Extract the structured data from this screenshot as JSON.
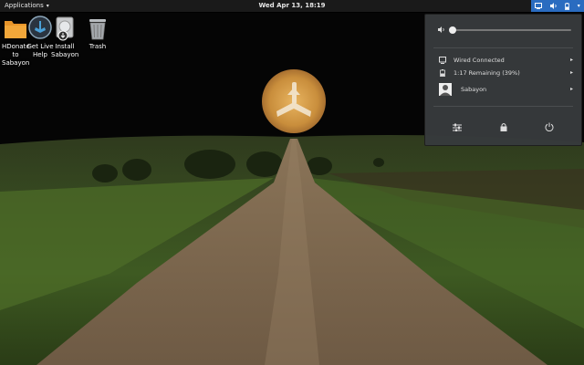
{
  "topbar": {
    "activities_label": "Applications",
    "clock": "Wed Apr 13, 18:19"
  },
  "desktop_icons": [
    {
      "label": "HDonate to Sabayon",
      "icon": "folder-icon"
    },
    {
      "label": "Get Live Help",
      "icon": "sabayon-help-icon"
    },
    {
      "label": "Install Sabayon",
      "icon": "installer-icon"
    },
    {
      "label": "Trash",
      "icon": "trash-icon"
    }
  ],
  "desktop_icon_lines": [
    [
      "HDonate to",
      "Sabayon"
    ],
    [
      "Get Live",
      "Help"
    ],
    [
      "Install",
      "Sabayon"
    ],
    [
      "Trash",
      ""
    ]
  ],
  "system_menu": {
    "volume_level": 0.0,
    "network_label": "Wired Connected",
    "battery_label": "1:17 Remaining (39%)",
    "user_label": "Sabayon"
  },
  "colors": {
    "topbar": "#1a1a1a",
    "status_highlight": "#2a6cc0",
    "menu_bg": "#373a3c",
    "moon": "#d9a04a"
  }
}
